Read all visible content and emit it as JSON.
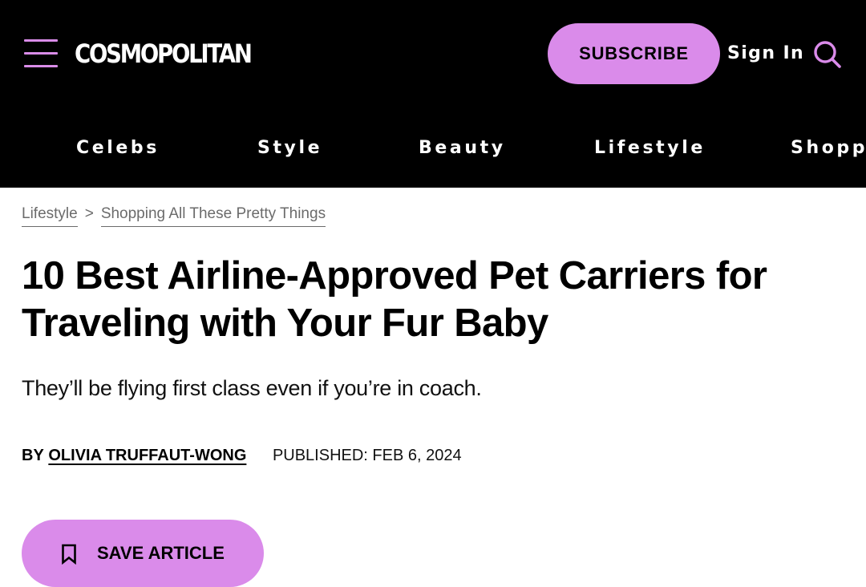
{
  "header": {
    "logo": "COSMOPOLITAN",
    "subscribe_label": "SUBSCRIBE",
    "signin_label": "Sign In",
    "menu_icon": "hamburger-menu-icon",
    "search_icon": "search-icon",
    "background_color": "#000000",
    "accent_color": "#da8bea"
  },
  "nav": {
    "items": [
      {
        "label": "Celebs"
      },
      {
        "label": "Style"
      },
      {
        "label": "Beauty"
      },
      {
        "label": "Lifestyle"
      },
      {
        "label": "Shoppi"
      }
    ]
  },
  "breadcrumb": {
    "items": [
      {
        "label": "Lifestyle"
      },
      {
        "label": "Shopping All These Pretty Things"
      }
    ],
    "separator": ">"
  },
  "article": {
    "title": "10 Best Airline-Approved Pet Carriers for Traveling with Your Fur Baby",
    "dek": "They’ll be flying first class even if you’re in coach.",
    "byline_prefix": "BY",
    "author": "OLIVIA TRUFFAUT-WONG",
    "published": "PUBLISHED: FEB 6, 2024",
    "save_label": "SAVE ARTICLE",
    "save_icon": "bookmark-icon"
  }
}
